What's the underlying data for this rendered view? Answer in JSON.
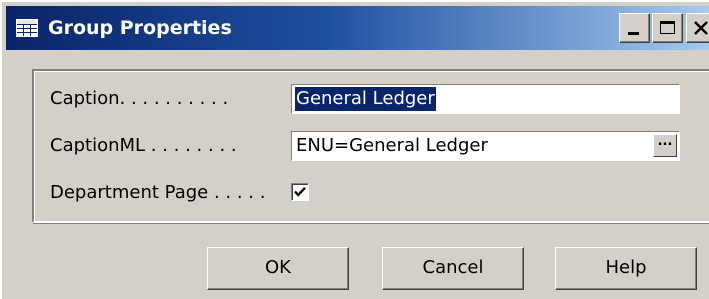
{
  "window": {
    "title": "Group Properties",
    "icon": "properties-table-icon",
    "controls": {
      "minimize_icon": "minimize-icon",
      "maximize_icon": "maximize-icon",
      "close_icon": "close-icon"
    }
  },
  "fields": {
    "caption": {
      "label": "Caption. . . . . . . . . .",
      "value": "General Ledger"
    },
    "captionml": {
      "label": "CaptionML . . . . . . . .",
      "value": "ENU=General Ledger",
      "assist_label": "..."
    },
    "department_page": {
      "label": "Department Page . . . . .",
      "checked": true
    }
  },
  "buttons": {
    "ok": "OK",
    "cancel": "Cancel",
    "help": "Help"
  },
  "colors": {
    "title_bar_start": "#0a246a",
    "title_bar_end": "#a6caf0",
    "dialog_face": "#d4d0c8",
    "selection": "#0a246a"
  }
}
